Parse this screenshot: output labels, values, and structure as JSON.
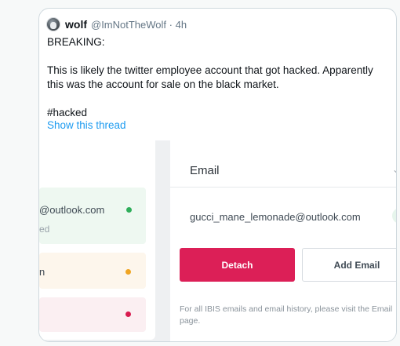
{
  "tweet": {
    "display_name": "wolf",
    "handle": "@ImNotTheWolf",
    "separator": "·",
    "time": "4h",
    "paragraphs": [
      "BREAKING:",
      "This is likely the twitter employee account that got hacked. Apparently this was the account for sale on the black market.",
      "#hacked"
    ],
    "show_thread": "Show this thread"
  },
  "media": {
    "left_panel": {
      "email_fragment": "@outlook.com",
      "status_fragment": "ed",
      "second_row_fragment": "n"
    },
    "right_panel": {
      "title": "Email",
      "email_value": "gucci_mane_lemonade@outlook.com",
      "detach_label": "Detach",
      "add_email_label": "Add Email",
      "note": "For all IBIS emails and email history, please visit the Email page."
    }
  },
  "colors": {
    "link": "#1d9bf0",
    "detach": "#dc1f57",
    "status_green": "#2fae5b",
    "status_yellow": "#f0a522",
    "status_red": "#d81b4f"
  },
  "icons": [
    "avatar-image",
    "chevron-down-icon",
    "status-dot-icon"
  ]
}
